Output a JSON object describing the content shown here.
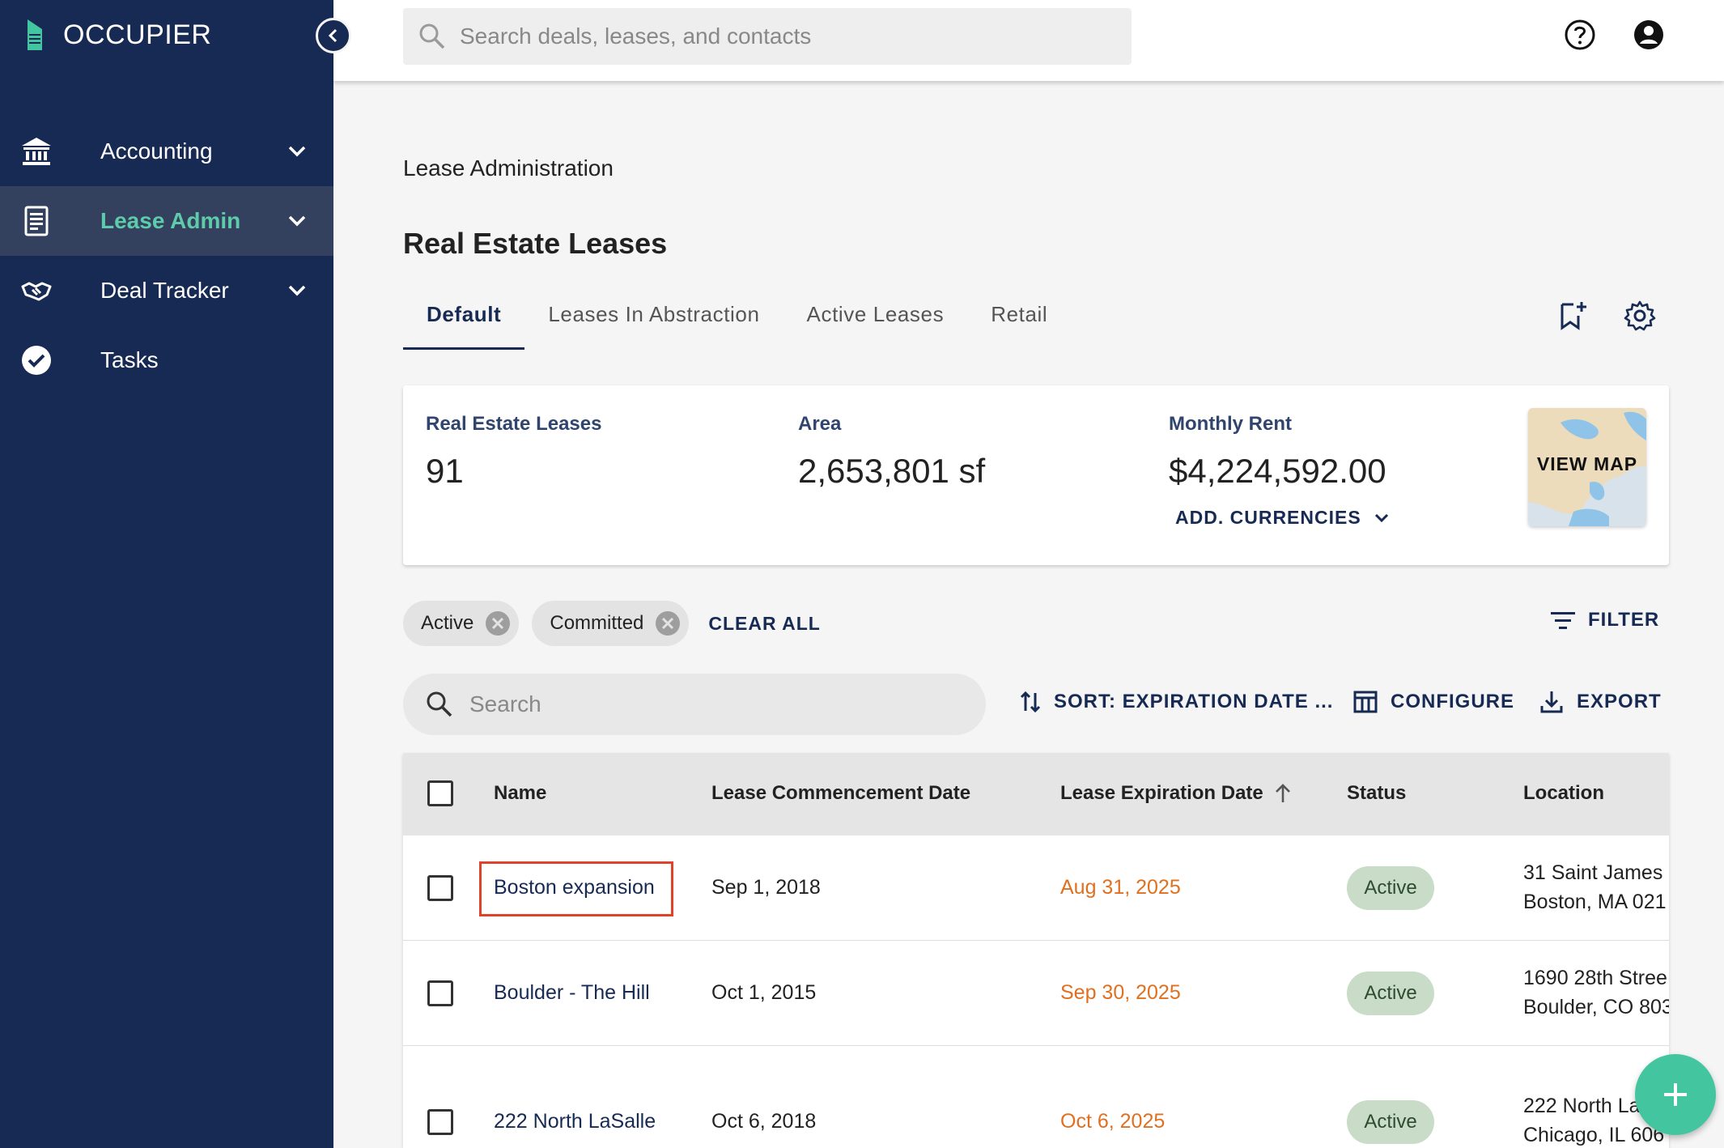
{
  "app": {
    "name": "OCCUPIER"
  },
  "sidebar": {
    "items": [
      {
        "label": "Accounting",
        "icon": "bank-icon",
        "expandable": true
      },
      {
        "label": "Lease Admin",
        "icon": "document-icon",
        "expandable": true,
        "active": true
      },
      {
        "label": "Deal Tracker",
        "icon": "handshake-icon",
        "expandable": true
      },
      {
        "label": "Tasks",
        "icon": "check-circle-icon",
        "expandable": false
      }
    ]
  },
  "topbar": {
    "search_placeholder": "Search deals, leases, and contacts"
  },
  "page": {
    "breadcrumb": "Lease Administration",
    "title": "Real Estate Leases",
    "tabs": [
      "Default",
      "Leases In Abstraction",
      "Active Leases",
      "Retail"
    ],
    "active_tab": "Default"
  },
  "summary": {
    "leases_label": "Real Estate Leases",
    "leases_value": "91",
    "area_label": "Area",
    "area_value": "2,653,801 sf",
    "rent_label": "Monthly Rent",
    "rent_value": "$4,224,592.00",
    "currencies_label": "ADD. CURRENCIES",
    "map_label": "VIEW MAP"
  },
  "filters": {
    "chips": [
      "Active",
      "Committed"
    ],
    "clear_all": "CLEAR ALL",
    "filter_label": "FILTER"
  },
  "toolbar": {
    "search_placeholder": "Search",
    "sort_label": "SORT: EXPIRATION DATE ...",
    "configure_label": "CONFIGURE",
    "export_label": "EXPORT"
  },
  "table": {
    "columns": [
      "Name",
      "Lease Commencement Date",
      "Lease Expiration Date",
      "Status",
      "Location"
    ],
    "rows": [
      {
        "name": "Boston expansion",
        "commencement": "Sep 1, 2018",
        "expiration": "Aug 31, 2025",
        "status": "Active",
        "location_line1": "31 Saint James",
        "location_line2": "Boston, MA 021"
      },
      {
        "name": "Boulder - The Hill",
        "commencement": "Oct 1, 2015",
        "expiration": "Sep 30, 2025",
        "status": "Active",
        "location_line1": "1690 28th Stree",
        "location_line2": "Boulder, CO 803"
      },
      {
        "name": "222 North LaSalle",
        "commencement": "Oct 6, 2018",
        "expiration": "Oct 6, 2025",
        "status": "Active",
        "location_line1": "222 North La",
        "location_line2": "Chicago, IL 606"
      }
    ]
  },
  "colors": {
    "sidebar_bg": "#172a54",
    "active_nav_text": "#5ecbaa",
    "expiration_text": "#e07020",
    "status_pill_bg": "#c8dcc8",
    "fab_bg": "#43c6a0",
    "highlight_border": "#e0432b"
  }
}
